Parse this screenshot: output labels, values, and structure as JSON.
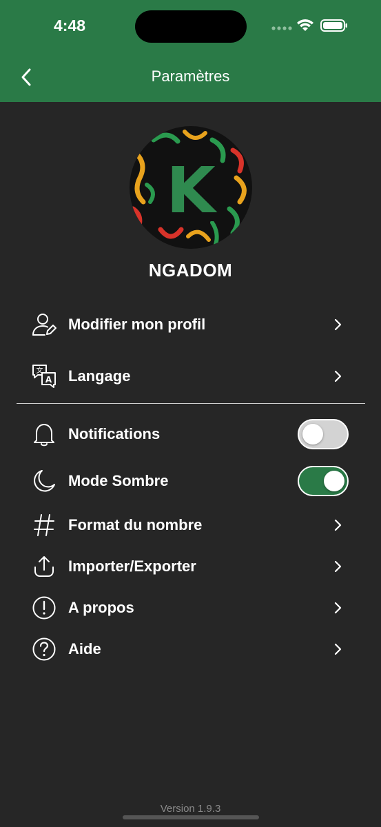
{
  "status_bar": {
    "time": "4:48"
  },
  "nav": {
    "title": "Paramètres",
    "back_icon": "chevron-left-icon"
  },
  "profile": {
    "username": "NGADOM",
    "avatar_letter": "K"
  },
  "menu_top": [
    {
      "label": "Modifier mon profil",
      "icon": "user-edit-icon"
    },
    {
      "label": "Langage",
      "icon": "translate-icon"
    }
  ],
  "toggles": [
    {
      "label": "Notifications",
      "icon": "bell-icon",
      "on": false
    },
    {
      "label": "Mode Sombre",
      "icon": "moon-icon",
      "on": true
    }
  ],
  "menu_bottom": [
    {
      "label": "Format du nombre",
      "icon": "hash-icon"
    },
    {
      "label": "Importer/Exporter",
      "icon": "upload-icon"
    },
    {
      "label": "A propos",
      "icon": "info-circle-icon"
    },
    {
      "label": "Aide",
      "icon": "help-circle-icon"
    }
  ],
  "footer": {
    "version": "Version 1.9.3"
  },
  "colors": {
    "accent": "#2a7a47",
    "background": "#262626"
  }
}
